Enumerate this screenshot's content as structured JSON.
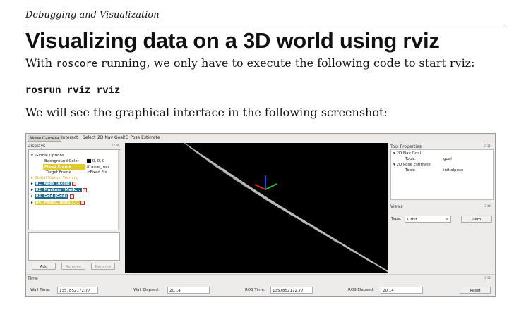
{
  "header": {
    "running_title": "Debugging and Visualization"
  },
  "heading": "Visualizing data on a 3D world using rviz",
  "para1": {
    "before": "With ",
    "code": "roscore",
    "after": " running, we only have to execute the following code to start rviz:"
  },
  "command": "rosrun rviz rviz",
  "para2": "We will see the graphical interface in the following screenshot:",
  "rviz": {
    "toolbar": [
      "Move Camera",
      "Interact",
      "Select",
      "2D Nav Goal",
      "2D Pose Estimate"
    ],
    "displays_title": "Displays",
    "panel_controls": "⊡⊠",
    "tree": {
      "global_options": ".Global Options",
      "bg_label": "Background Color",
      "bg_value": "0, 0, 0",
      "fixed_label": "Fixed Frame",
      "fixed_value": "/frame_mar",
      "target_label": "Target Frame",
      "target_value": "<Fixed Fra...",
      "status": "Global Status: Warning",
      "items": [
        "01. Axes (Axes)",
        "02. Markers (Mark...",
        "03. Grid (Grid)",
        "04. PointCloud2 (..."
      ]
    },
    "buttons": {
      "add": "Add",
      "remove": "Remove",
      "rename": "Rename",
      "zero": "Zero",
      "reset": "Reset"
    },
    "tool_properties": {
      "title": "Tool Properties",
      "nav_goal": "2D Nav Goal",
      "topic_label": "Topic",
      "nav_topic": "goal",
      "pose_estimate": "2D Pose Estimate",
      "pose_topic": "initialpose"
    },
    "views": {
      "title": "Views",
      "type_label": "Type:",
      "type_value": "Orbit"
    },
    "time": {
      "title": "Time",
      "wall_time_label": "Wall Time:",
      "wall_time": "1357852172.77",
      "wall_elapsed_label": "Wall Elapsed:",
      "wall_elapsed": "20.14",
      "ros_time_label": "ROS Time:",
      "ros_time": "1357852172.77",
      "ros_elapsed_label": "ROS Elapsed:",
      "ros_elapsed": "20.14"
    },
    "colors": {
      "selected_row": "#1f6b8a",
      "warning_row": "#e2c92c",
      "x_axis": "#e02020",
      "y_axis": "#20c020",
      "z_axis": "#2040ff"
    }
  }
}
